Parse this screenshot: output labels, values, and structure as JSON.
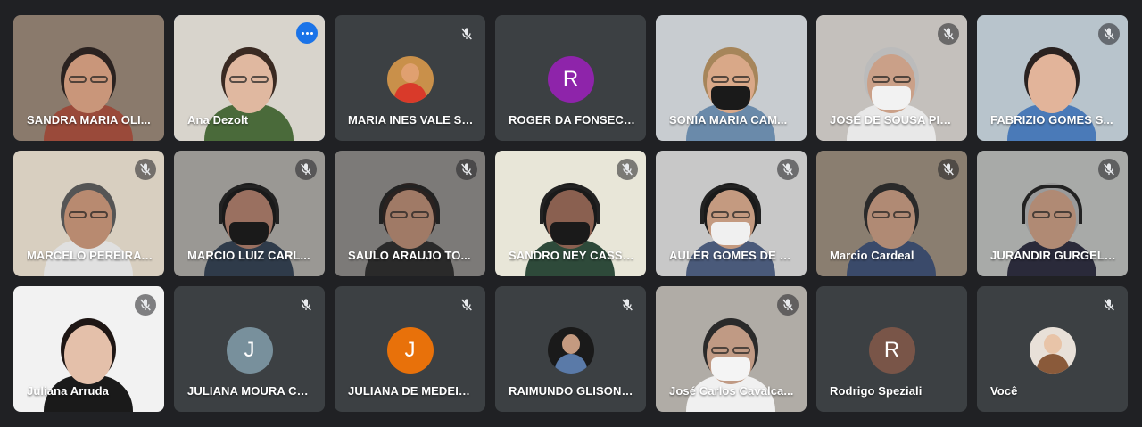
{
  "participants": [
    {
      "name": "SANDRA MARIA OLI...",
      "type": "video",
      "muted": false,
      "active": false,
      "bg": "#8a7a6c",
      "skin": "#c9967a",
      "hair": "#2a2220",
      "shirt": "#9a4a3a",
      "mask": false,
      "glasses": true
    },
    {
      "name": "Ana Dezolt",
      "type": "video",
      "muted": false,
      "active": true,
      "bg": "#d8d4cc",
      "skin": "#e0b8a0",
      "hair": "#3a2a22",
      "shirt": "#4a6a3a",
      "mask": false,
      "glasses": true
    },
    {
      "name": "MARIA INES VALE SIL...",
      "type": "photo-avatar",
      "muted": true,
      "avatar_bg": "#c9904a",
      "avatar_skin": "#e0a070",
      "avatar_shirt": "#d93a2a"
    },
    {
      "name": "ROGER DA FONSECA ...",
      "type": "letter-avatar",
      "muted": false,
      "letter": "R",
      "avatar_bg": "#8e24aa"
    },
    {
      "name": "SONIA MARIA CAM...",
      "type": "video",
      "muted": false,
      "active": false,
      "bg": "#c8ccd0",
      "skin": "#d9a888",
      "hair": "#a6855a",
      "shirt": "#6a8aaa",
      "mask": true,
      "mask_color": "#1a1a1a",
      "glasses": true
    },
    {
      "name": "JOSE DE SOUSA PIN...",
      "type": "video",
      "muted": true,
      "active": false,
      "bg": "#c4c0bc",
      "skin": "#caa088",
      "hair": "#bbbbbb",
      "shirt": "#e8e8e8",
      "mask": true,
      "mask_color": "#f2f2f2",
      "glasses": true
    },
    {
      "name": "FABRIZIO GOMES S...",
      "type": "video",
      "muted": true,
      "active": false,
      "bg": "#b8c4cc",
      "skin": "#e2b49a",
      "hair": "#2a2220",
      "shirt": "#4a7ab8",
      "mask": false,
      "glasses": false
    },
    {
      "name": "MARCELO PEREIRA ...",
      "type": "video",
      "muted": true,
      "active": false,
      "bg": "#d8cfc0",
      "skin": "#b88a70",
      "hair": "#555555",
      "shirt": "#e0e0e0",
      "mask": false,
      "glasses": true
    },
    {
      "name": "MARCIO LUIZ CARL...",
      "type": "video",
      "muted": true,
      "active": false,
      "bg": "#9a9894",
      "skin": "#9a7060",
      "hair": "#1a1a1a",
      "shirt": "#2f3b4a",
      "mask": true,
      "mask_color": "#1a1a1a",
      "glasses": false,
      "headset": true
    },
    {
      "name": "SAULO ARAUJO TO...",
      "type": "video",
      "muted": true,
      "active": false,
      "bg": "#7c7a78",
      "skin": "#a07a66",
      "hair": "#2a2220",
      "shirt": "#2a2a2a",
      "mask": false,
      "glasses": true,
      "headset": true
    },
    {
      "name": "SANDRO NEY CASSI...",
      "type": "video",
      "muted": true,
      "active": false,
      "bg": "#e8e6d8",
      "skin": "#8a6050",
      "hair": "#1a1a1a",
      "shirt": "#2e4a3a",
      "mask": true,
      "mask_color": "#1a1a1a",
      "glasses": false,
      "headset": true
    },
    {
      "name": "AULER GOMES DE S...",
      "type": "video",
      "muted": true,
      "active": false,
      "bg": "#c8c8c8",
      "skin": "#c49a80",
      "hair": "#1a1a1a",
      "shirt": "#4a5a7a",
      "mask": true,
      "mask_color": "#f0f0f0",
      "glasses": true,
      "headset": true
    },
    {
      "name": "Marcio Cardeal",
      "type": "video",
      "muted": true,
      "active": false,
      "bg": "#8a7e70",
      "skin": "#b08a74",
      "hair": "#2a2a2a",
      "shirt": "#3a4a6a",
      "mask": false,
      "glasses": true
    },
    {
      "name": "JURANDIR GURGEL ...",
      "type": "video",
      "muted": true,
      "active": false,
      "bg": "#a8aaa8",
      "skin": "#b08a74",
      "hair": "#9a9a9a",
      "shirt": "#2a2a3a",
      "mask": false,
      "glasses": true,
      "headset": true
    },
    {
      "name": "Juliana Arruda",
      "type": "video",
      "muted": true,
      "active": false,
      "bg": "#f2f2f2",
      "skin": "#e4c0aa",
      "hair": "#1e1614",
      "shirt": "#1a1a1a",
      "mask": false,
      "glasses": false
    },
    {
      "name": "JULIANA MOURA CA...",
      "type": "letter-avatar",
      "muted": true,
      "letter": "J",
      "avatar_bg": "#78909c"
    },
    {
      "name": "JULIANA DE MEDEIR...",
      "type": "letter-avatar",
      "muted": true,
      "letter": "J",
      "avatar_bg": "#e8710a"
    },
    {
      "name": "RAIMUNDO GLISON P...",
      "type": "photo-avatar",
      "muted": true,
      "avatar_bg": "#1a1a1a",
      "avatar_skin": "#c49a80",
      "avatar_shirt": "#5a7aa8"
    },
    {
      "name": "José Carlos Cavalca...",
      "type": "video",
      "muted": true,
      "active": false,
      "bg": "#b0aca6",
      "skin": "#c09a84",
      "hair": "#2a2a2a",
      "shirt": "#f0f0f0",
      "mask": true,
      "mask_color": "#f4f4f4",
      "glasses": true
    },
    {
      "name": "Rodrigo Speziali",
      "type": "letter-avatar",
      "muted": false,
      "letter": "R",
      "avatar_bg": "#795548"
    },
    {
      "name": "Você",
      "type": "photo-avatar",
      "muted": true,
      "avatar_bg": "#e8e0d8",
      "avatar_skin": "#e8c4a8",
      "avatar_shirt": "#8a5a3a"
    }
  ]
}
